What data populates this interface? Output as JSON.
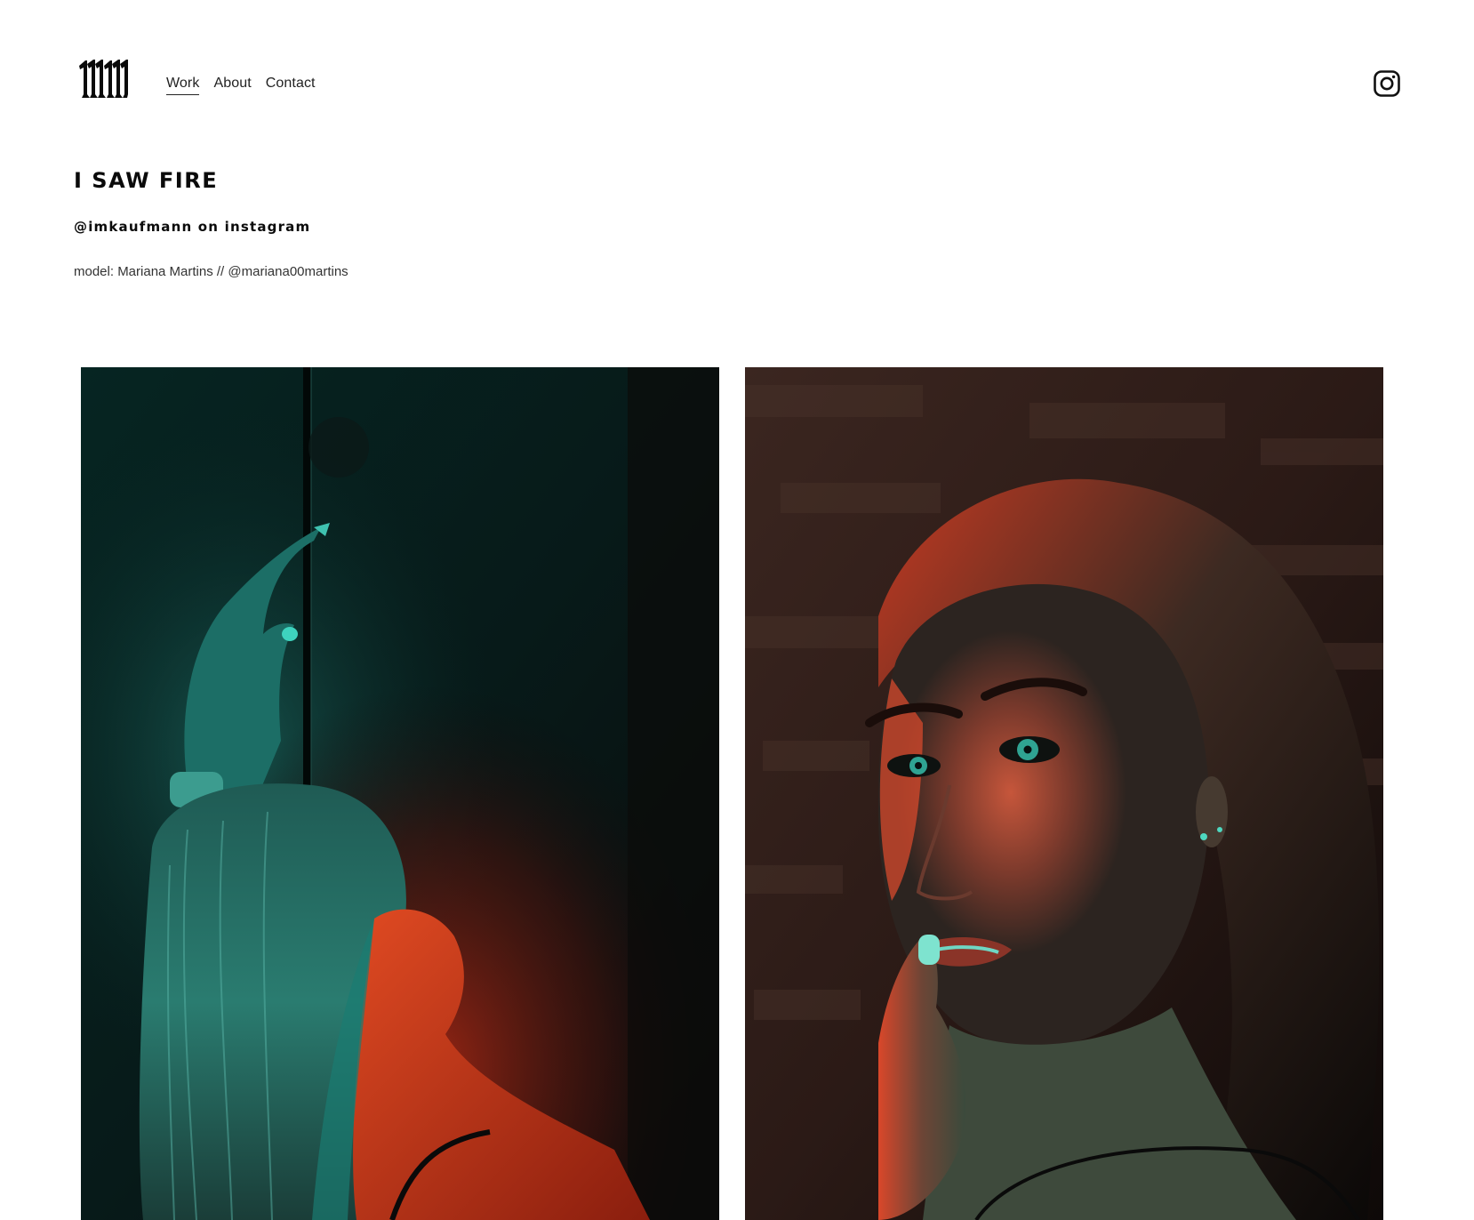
{
  "header": {
    "logo_alt": "MM monogram logo",
    "nav": [
      {
        "label": "Work",
        "active": true
      },
      {
        "label": "About",
        "active": false
      },
      {
        "label": "Contact",
        "active": false
      }
    ],
    "social_icon": "instagram-icon"
  },
  "page": {
    "title": "I SAW FIRE",
    "handle": "@imkaufmann on instagram",
    "model_credit": "model: Mariana Martins // @mariana00martins"
  },
  "gallery": {
    "photos": [
      {
        "alt": "Model with hand raised behind a glass shower door, lit in teal and red"
      },
      {
        "alt": "Portrait of model looking over shoulder, lit in red and teal"
      }
    ]
  },
  "colors": {
    "background": "#ffffff",
    "text": "#111111",
    "teal_light": "#1fa89a",
    "red_light": "#d23a1f"
  }
}
